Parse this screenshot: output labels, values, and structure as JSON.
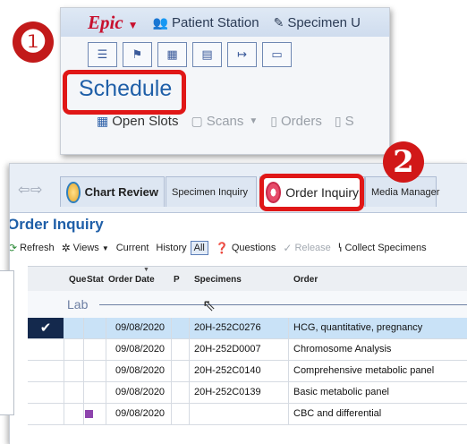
{
  "badges": {
    "one": "❶",
    "two": "2"
  },
  "panel1": {
    "top": {
      "epic_label": "Epic",
      "items": [
        "Patient Station",
        "Specimen U"
      ]
    },
    "toolbar_icons": [
      "list-icon",
      "flag-icon",
      "calendar-icon",
      "chart-icon",
      "export-icon",
      "message-icon"
    ],
    "title": "Schedule",
    "tools": {
      "open_slots": "Open Slots",
      "scans": "Scans",
      "orders": "Orders",
      "cut": "S"
    }
  },
  "panel2": {
    "tabs": {
      "chart_review": "Chart Review",
      "specimen_inquiry": "Specimen Inquiry",
      "order_inquiry": "Order Inquiry",
      "media_manager": "Media Manager"
    },
    "title": "Order Inquiry",
    "tools": {
      "refresh": "Refresh",
      "views": "Views",
      "current": "Current",
      "history": "History",
      "all": "All",
      "questions": "Questions",
      "release": "Release",
      "collect": "Collect Specimens"
    },
    "columns": {
      "que": "Que",
      "stat": "Stat",
      "order_date": "Order Date",
      "p": "P",
      "specimens": "Specimens",
      "order": "Order"
    },
    "group": "Lab",
    "rows": [
      {
        "date": "09/08/2020",
        "specimen": "20H-252C0276",
        "order": "HCG, quantitative, pregnancy"
      },
      {
        "date": "09/08/2020",
        "specimen": "20H-252D0007",
        "order": "Chromosome Analysis"
      },
      {
        "date": "09/08/2020",
        "specimen": "20H-252C0140",
        "order": "Comprehensive metabolic panel"
      },
      {
        "date": "09/08/2020",
        "specimen": "20H-252C0139",
        "order": "Basic metabolic panel"
      },
      {
        "date": "09/08/2020",
        "specimen": "",
        "order": "CBC and differential"
      }
    ]
  },
  "colors": {
    "highlight": "#e01717",
    "badge": "#c21a1a",
    "title_blue": "#1f5fa8",
    "selected_row": "#c9e2f7",
    "status_purple": "#8e44ad"
  }
}
